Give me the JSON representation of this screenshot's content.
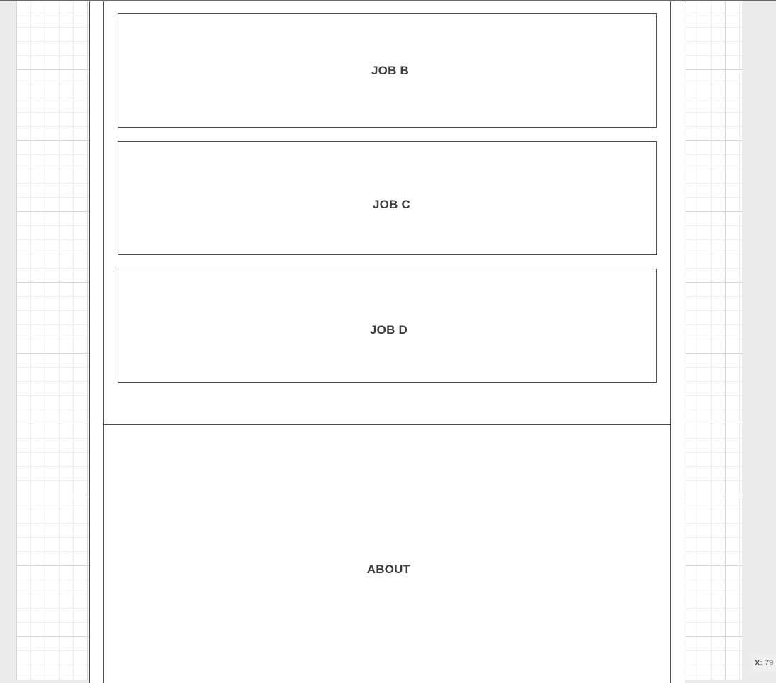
{
  "jobs": [
    {
      "label": "JOB B"
    },
    {
      "label": "JOB C"
    },
    {
      "label": "JOB D"
    }
  ],
  "about": {
    "title": "ABOUT"
  },
  "status": {
    "x_label": "X:",
    "x_value": "79"
  }
}
